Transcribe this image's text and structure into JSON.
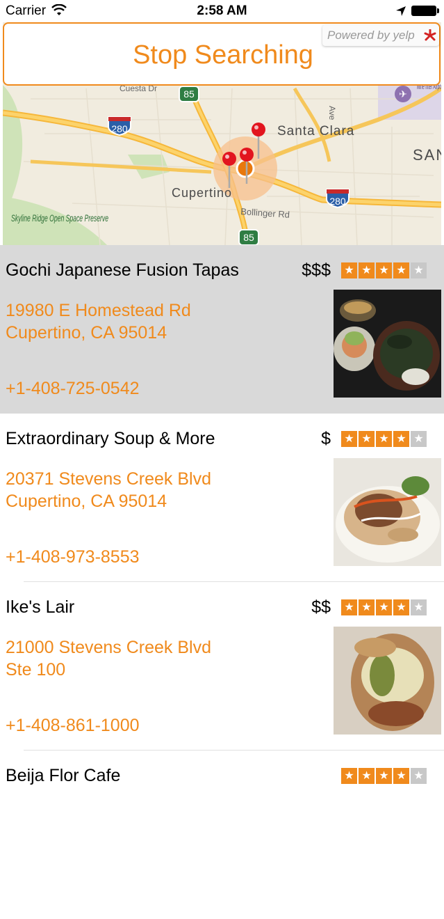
{
  "status": {
    "carrier": "Carrier",
    "time": "2:58 AM"
  },
  "search": {
    "stop_label": "Stop Searching",
    "powered_by": "Powered by yelp"
  },
  "map": {
    "labels": {
      "santa_clara": "Santa Clara",
      "cupertino": "Cupertino",
      "bollinger": "Bollinger Rd",
      "skyline": "Skyline Ridge Open Space Preserve",
      "cuesta": "Cuesta Dr",
      "ave": "Ave",
      "airport": "Mine Inter Airpo",
      "san": "SAN"
    },
    "shields": {
      "i280_a": "280",
      "i280_b": "280",
      "hwy85_a": "85",
      "hwy85_b": "85"
    }
  },
  "results": [
    {
      "name": "Gochi Japanese Fusion Tapas",
      "price": "$$$",
      "rating": 4,
      "address_line1": "19980 E Homestead Rd",
      "address_line2": "Cupertino, CA 95014",
      "phone": "+1-408-725-0542",
      "selected": true
    },
    {
      "name": "Extraordinary Soup & More",
      "price": "$",
      "rating": 4,
      "address_line1": "20371 Stevens Creek Blvd",
      "address_line2": "Cupertino, CA 95014",
      "phone": "+1-408-973-8553",
      "selected": false
    },
    {
      "name": "Ike's Lair",
      "price": "$$",
      "rating": 4,
      "address_line1": "21000 Stevens Creek Blvd",
      "address_line2": "Ste 100",
      "phone": "+1-408-861-1000",
      "selected": false
    },
    {
      "name": "Beija Flor Cafe",
      "price": "",
      "rating": 4,
      "address_line1": "",
      "address_line2": "",
      "phone": "",
      "selected": false
    }
  ],
  "colors": {
    "accent": "#f08a1c",
    "selected_row": "#d9d9d9"
  }
}
